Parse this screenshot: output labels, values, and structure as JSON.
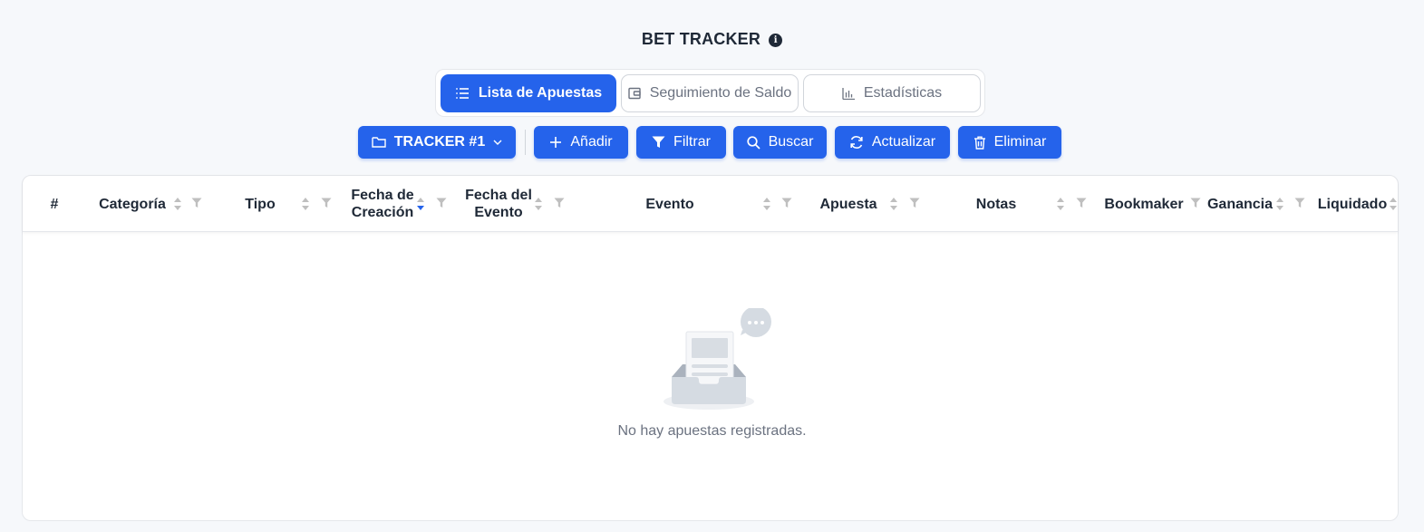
{
  "header": {
    "title": "BET TRACKER",
    "info_icon": "info-icon"
  },
  "tabs": [
    {
      "label": "Lista de Apuestas",
      "icon": "list-icon",
      "active": true
    },
    {
      "label": "Seguimiento de Saldo",
      "icon": "wallet-icon",
      "active": false
    },
    {
      "label": "Estadísticas",
      "icon": "bar-chart-icon",
      "active": false
    }
  ],
  "toolbar": {
    "tracker_label": "TRACKER #1",
    "add_label": "Añadir",
    "filter_label": "Filtrar",
    "search_label": "Buscar",
    "refresh_label": "Actualizar",
    "delete_label": "Eliminar"
  },
  "table": {
    "columns": {
      "number": "#",
      "category": "Categoría",
      "type": "Tipo",
      "created_line1": "Fecha de",
      "created_line2": "Creación",
      "event_date_line1": "Fecha del",
      "event_date_line2": "Evento",
      "event": "Evento",
      "bet": "Apuesta",
      "notes": "Notas",
      "bookmaker": "Bookmaker",
      "profit": "Ganancia",
      "settled": "Liquidado"
    },
    "empty_text": "No hay apuestas registradas."
  },
  "colors": {
    "primary": "#2563eb",
    "background": "#f6f8fb",
    "text": "#1f2937",
    "muted": "#6b7280"
  }
}
